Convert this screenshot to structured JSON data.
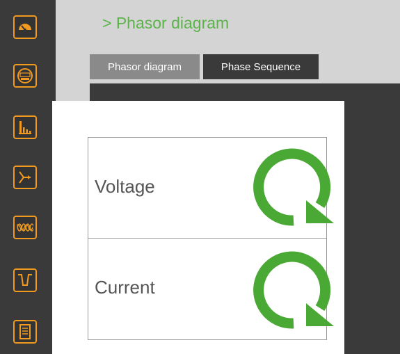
{
  "breadcrumb": {
    "text": "> Phasor diagram"
  },
  "tabs": [
    {
      "label": "Phasor diagram"
    },
    {
      "label": "Phase Sequence"
    }
  ],
  "phase_sequence": [
    {
      "label": "Voltage",
      "icon": "clockwise-rotation-icon"
    },
    {
      "label": "Current",
      "icon": "clockwise-rotation-icon"
    }
  ],
  "sidebar": {
    "items": [
      {
        "icon": "gauge-icon"
      },
      {
        "icon": "meter-icon"
      },
      {
        "icon": "bar-chart-icon"
      },
      {
        "icon": "phasor-icon"
      },
      {
        "icon": "waveform-icon"
      },
      {
        "icon": "dip-icon"
      },
      {
        "icon": "list-icon"
      }
    ]
  },
  "colors": {
    "accent": "#f29a1f",
    "sidebar_bg": "#3a3a3a",
    "breadcrumb": "#5bb34a",
    "rotation": "#4aa834"
  }
}
